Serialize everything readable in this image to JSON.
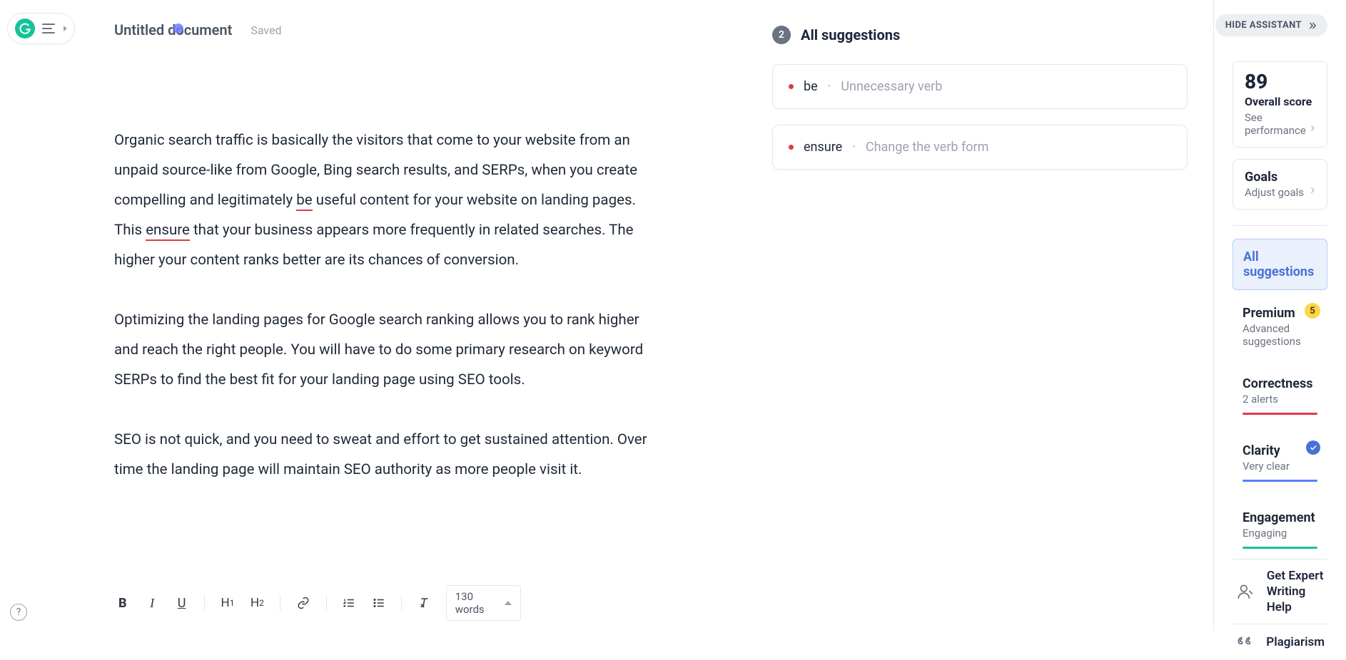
{
  "header": {
    "doc_title": "Untitled document",
    "saved_label": "Saved"
  },
  "editor": {
    "p1_a": "Organic search traffic is basically the visitors that come to your website from an unpaid source-like from Google, Bing search results, and SERPs, when you create compelling and legitimately ",
    "p1_err1": "be",
    "p1_b": " useful content for your website on landing pages. This ",
    "p1_err2": "ensure",
    "p1_c": " that your business appears more frequently in related searches. The higher your content ranks better are its chances of conversion.",
    "p2": "Optimizing the landing pages for Google search ranking allows you to rank higher and reach the right people. You will have to do some primary research on keyword SERPs to find the best fit for your landing page using SEO tools.",
    "p3": " SEO is not quick, and you need to sweat and effort to get sustained attention. Over time the landing page will maintain SEO authority as more people visit it."
  },
  "toolbar": {
    "bold": "B",
    "italic": "I",
    "underline": "U",
    "h1": "H1",
    "h2": "H2",
    "words_label": "130 words"
  },
  "suggestions": {
    "count": "2",
    "title": "All suggestions",
    "cards": [
      {
        "word": "be",
        "sep": "·",
        "desc": "Unnecessary verb"
      },
      {
        "word": "ensure",
        "sep": "·",
        "desc": "Change the verb form"
      }
    ]
  },
  "side": {
    "hide_label": "HIDE ASSISTANT",
    "score": {
      "value": "89",
      "label": "Overall score",
      "sub": "See performance"
    },
    "goals": {
      "title": "Goals",
      "sub": "Adjust goals"
    },
    "cats": {
      "all": {
        "title": "All suggestions"
      },
      "premium": {
        "title": "Premium",
        "sub": "Advanced suggestions",
        "badge": "5"
      },
      "correctness": {
        "title": "Correctness",
        "sub": "2 alerts"
      },
      "clarity": {
        "title": "Clarity",
        "sub": "Very clear"
      },
      "engagement": {
        "title": "Engagement",
        "sub": "Engaging"
      }
    },
    "expert": {
      "l1": "Get Expert",
      "l2": "Writing Help"
    },
    "plagiarism": "Plagiarism"
  }
}
